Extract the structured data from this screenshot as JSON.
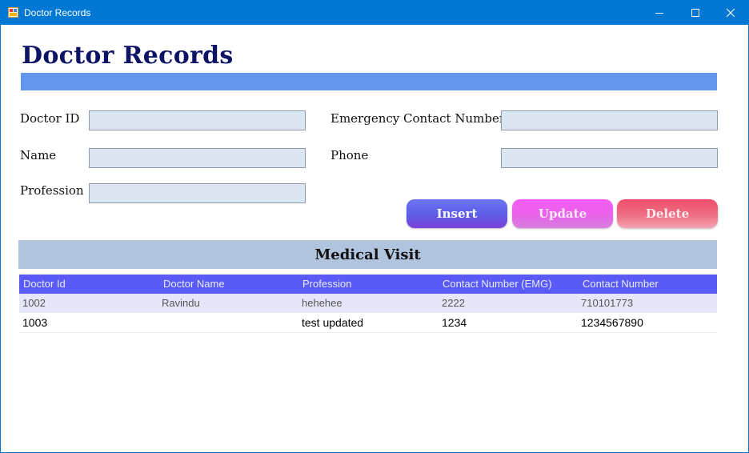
{
  "window": {
    "title": "Doctor Records",
    "controls": {
      "minimize": "minimize",
      "maximize": "maximize",
      "close": "close"
    }
  },
  "form": {
    "heading": "Doctor Records",
    "fields": {
      "doctor_id": {
        "label": "Doctor ID",
        "value": ""
      },
      "name": {
        "label": "Name",
        "value": ""
      },
      "profession": {
        "label": "Profession",
        "value": ""
      },
      "emergency_contact": {
        "label": "Emergency Contact Number",
        "value": ""
      },
      "phone": {
        "label": "Phone",
        "value": ""
      }
    },
    "buttons": {
      "insert": "Insert",
      "update": "Update",
      "delete": "Delete"
    }
  },
  "grid": {
    "title": "Medical Visit",
    "columns": [
      "Doctor Id",
      "Doctor Name",
      "Profession",
      "Contact Number (EMG)",
      "Contact Number"
    ],
    "rows": [
      [
        "1002",
        "Ravindu",
        "hehehee",
        "2222",
        "710101773"
      ],
      [
        "1003",
        "",
        "test updated",
        "1234",
        "1234567890"
      ]
    ]
  },
  "colors": {
    "titlebar": "#0078d4",
    "heading": "#0d1466",
    "accent_strip": "#6495ed",
    "section_header": "#b0c4de",
    "grid_header": "#5a5af7",
    "row_alt": "#e6e6fa"
  }
}
